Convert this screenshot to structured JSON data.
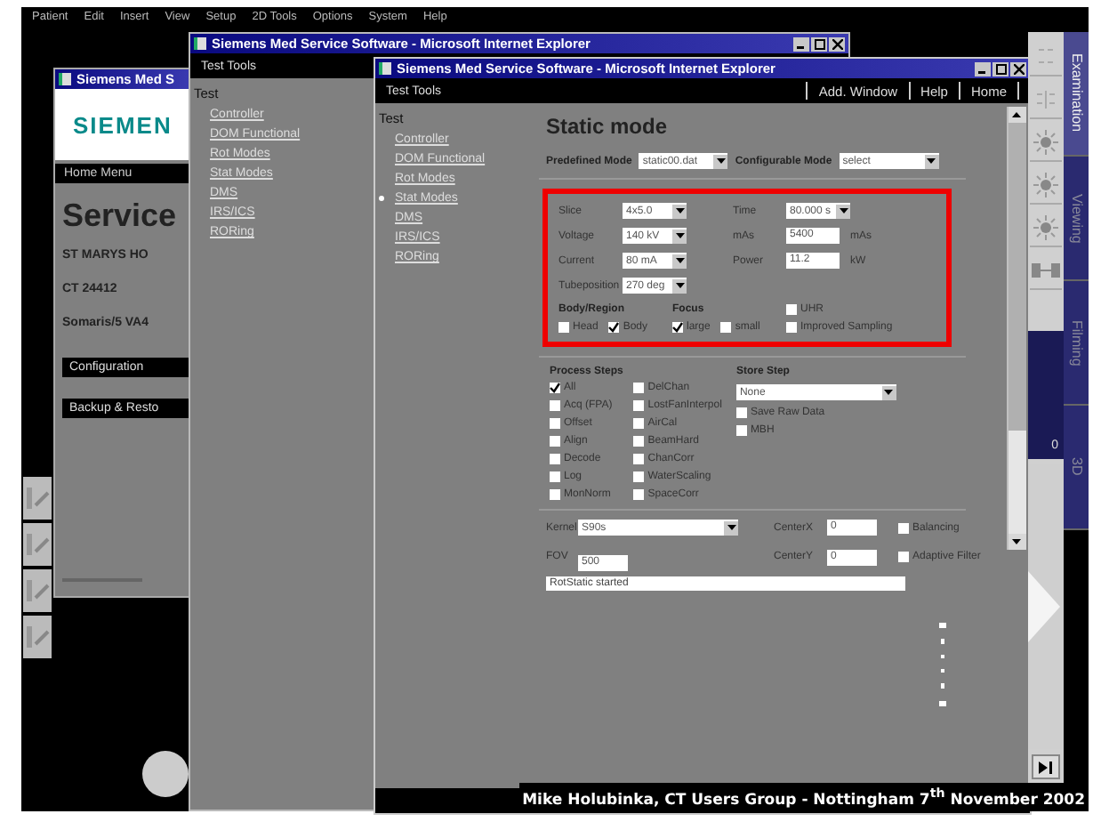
{
  "menu_bar": [
    "Patient",
    "Edit",
    "Insert",
    "View",
    "Setup",
    "2D Tools",
    "Options",
    "System",
    "Help"
  ],
  "home_window": {
    "title": "Siemens Med S",
    "logo": "SIEMEN",
    "header": "Home Menu",
    "heading": "Service",
    "lines": [
      "ST MARYS HO",
      "CT 24412",
      "Somaris/5 VA4"
    ],
    "buttons": [
      "Configuration",
      "Backup & Resto"
    ]
  },
  "test_window": {
    "title": "Siemens Med Service Software - Microsoft Internet Explorer",
    "header": "Test Tools",
    "nav_heading": "Test",
    "nav": [
      {
        "label": "Controller",
        "selected": false
      },
      {
        "label": "DOM Functional",
        "selected": false
      },
      {
        "label": "Rot Modes",
        "selected": false
      },
      {
        "label": "Stat Modes",
        "selected": false
      },
      {
        "label": "DMS",
        "selected": false
      },
      {
        "label": "IRS/ICS",
        "selected": false
      },
      {
        "label": "RORing",
        "selected": false
      }
    ]
  },
  "static_window": {
    "title": "Siemens Med Service Software - Microsoft Internet Explorer",
    "header": "Test Tools",
    "toolbar": [
      "Add. Window",
      "Help",
      "Home"
    ],
    "nav_heading": "Test",
    "nav": [
      {
        "label": "Controller",
        "selected": false
      },
      {
        "label": "DOM Functional",
        "selected": false
      },
      {
        "label": "Rot Modes",
        "selected": false
      },
      {
        "label": "Stat Modes",
        "selected": true
      },
      {
        "label": "DMS",
        "selected": false
      },
      {
        "label": "IRS/ICS",
        "selected": false
      },
      {
        "label": "RORing",
        "selected": false
      }
    ],
    "heading": "Static mode",
    "modes": [
      {
        "label": "Predefined Mode",
        "value": "static00.dat"
      },
      {
        "label": "Configurable Mode",
        "value": "select"
      }
    ],
    "scan_params": [
      [
        {
          "label": "Slice",
          "value": "4x5.0",
          "kind": "select"
        },
        {
          "label": "Time",
          "value": "80.000 s",
          "kind": "select"
        }
      ],
      [
        {
          "label": "Voltage",
          "value": "140 kV",
          "kind": "select"
        },
        {
          "label": "mAs",
          "value": "5400",
          "kind": "input",
          "unit": "mAs"
        }
      ],
      [
        {
          "label": "Current",
          "value": "80 mA",
          "kind": "select"
        },
        {
          "label": "Power",
          "value": "11.2",
          "kind": "input",
          "unit": "kW"
        }
      ],
      [
        {
          "label": "Tubeposition",
          "value": "270 deg",
          "kind": "select"
        }
      ]
    ],
    "body_region": {
      "label": "Body/Region",
      "options": [
        {
          "label": "Head",
          "checked": false
        },
        {
          "label": "Body",
          "checked": true
        }
      ]
    },
    "focus": {
      "label": "Focus",
      "options": [
        {
          "label": "large",
          "checked": true
        },
        {
          "label": "small",
          "checked": false
        }
      ]
    },
    "extras": [
      {
        "label": "UHR",
        "checked": false
      },
      {
        "label": "Improved Sampling",
        "checked": false
      }
    ],
    "process_steps": {
      "label": "Process Steps",
      "columns": [
        [
          {
            "label": "All",
            "checked": true
          },
          {
            "label": "Acq (FPA)",
            "checked": false
          },
          {
            "label": "Offset",
            "checked": false
          },
          {
            "label": "Align",
            "checked": false
          },
          {
            "label": "Decode",
            "checked": false
          },
          {
            "label": "Log",
            "checked": false
          },
          {
            "label": "MonNorm",
            "checked": false
          }
        ],
        [
          {
            "label": "DelChan",
            "checked": false
          },
          {
            "label": "LostFanInterpol",
            "checked": false
          },
          {
            "label": "AirCal",
            "checked": false
          },
          {
            "label": "BeamHard",
            "checked": false
          },
          {
            "label": "ChanCorr",
            "checked": false
          },
          {
            "label": "WaterScaling",
            "checked": false
          },
          {
            "label": "SpaceCorr",
            "checked": false
          }
        ]
      ]
    },
    "store_step": {
      "label": "Store Step",
      "value": "None",
      "options": [
        {
          "label": "Save Raw Data",
          "checked": false
        },
        {
          "label": "MBH",
          "checked": false
        }
      ]
    },
    "kernel": {
      "label": "Kernel",
      "value": "S90s"
    },
    "fov": {
      "label": "FOV",
      "value": "500"
    },
    "center_x": {
      "label": "CenterX",
      "value": "0"
    },
    "center_y": {
      "label": "CenterY",
      "value": "0"
    },
    "filters": [
      {
        "label": "Balancing",
        "checked": false
      },
      {
        "label": "Adaptive Filter",
        "checked": false
      }
    ],
    "status": "RotStatic started"
  },
  "side_tabs": [
    {
      "label": "Examination",
      "selected": true
    },
    {
      "label": "Viewing",
      "selected": false
    },
    {
      "label": "Filming",
      "selected": false
    },
    {
      "label": "3D",
      "selected": false
    }
  ],
  "side_counter": "0",
  "caption": "Mike Holubinka, CT Users Group - Nottingham 7$^{th}$ November 2002"
}
